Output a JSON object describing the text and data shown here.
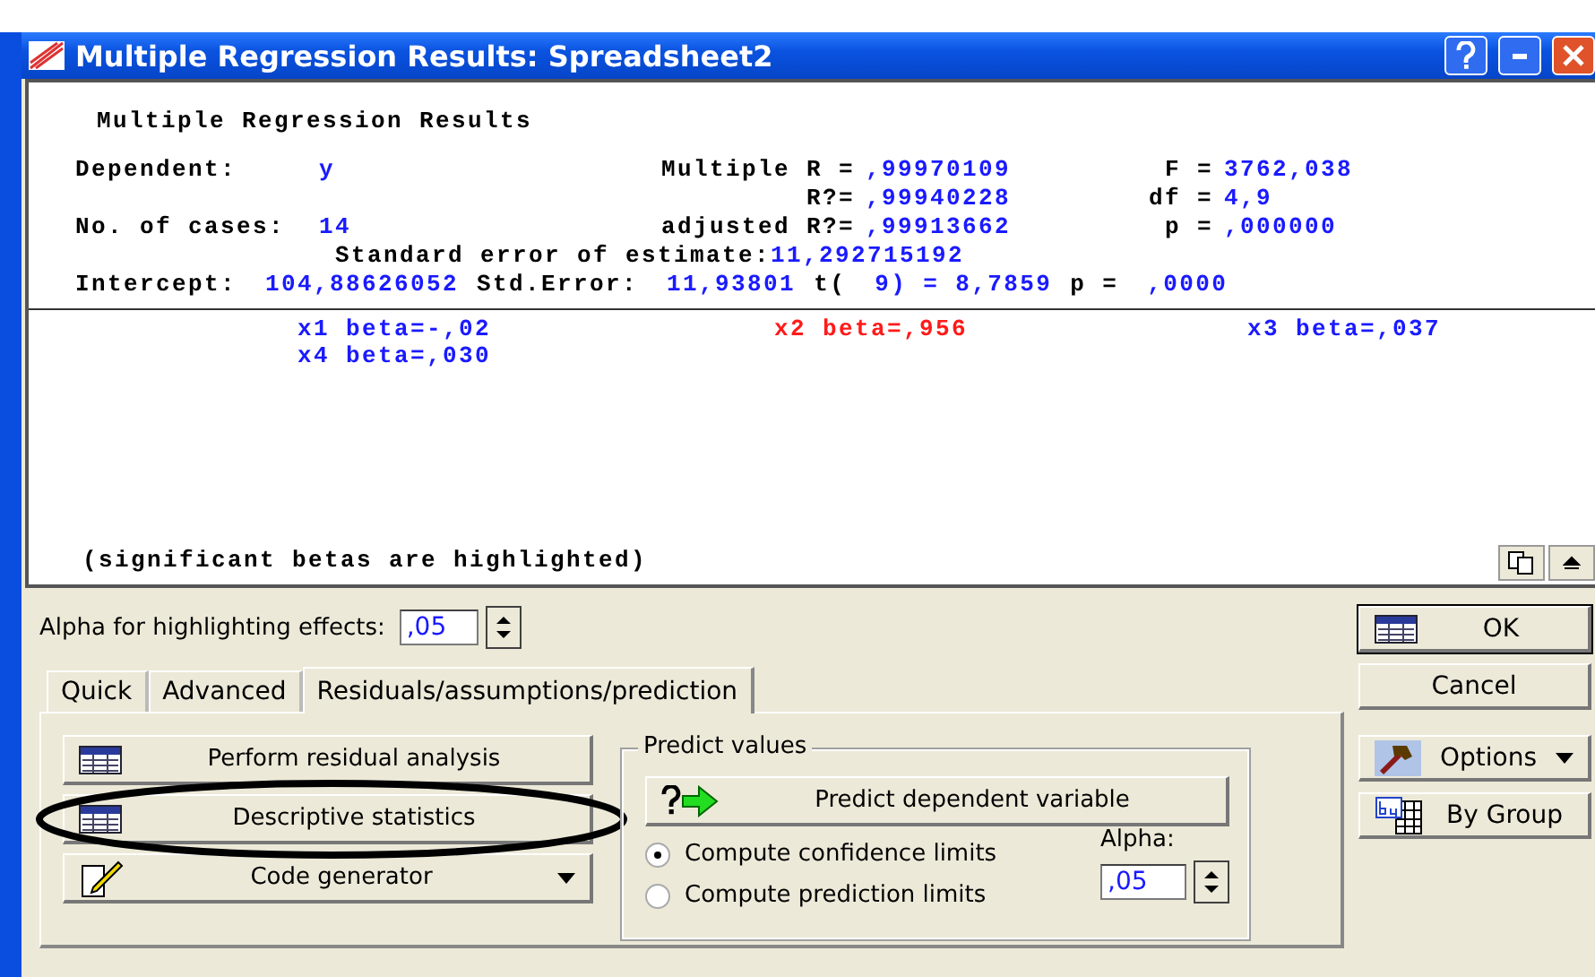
{
  "window": {
    "title": "Multiple Regression Results: Spreadsheet2"
  },
  "report": {
    "heading": "Multiple Regression Results",
    "stats_rows": [
      [
        {
          "label": "Dependent:",
          "value": "y"
        },
        {
          "label": "Multiple R =",
          "value": ",99970109"
        },
        {
          "label": "F =",
          "value": "3762,038"
        }
      ],
      [
        null,
        {
          "label": "R?=",
          "value": ",99940228"
        },
        {
          "label": "df =",
          "value": "4,9"
        }
      ],
      [
        {
          "label": "No. of cases:",
          "value": "14"
        },
        {
          "label": "adjusted R?=",
          "value": ",99913662"
        },
        {
          "label": "p =",
          "value": ",000000"
        }
      ]
    ],
    "std_error": {
      "label": "Standard error of estimate:",
      "value": "11,292715192"
    },
    "intercept_line": [
      {
        "kind": "label",
        "text": "Intercept:"
      },
      {
        "kind": "value",
        "text": "104,88626052"
      },
      {
        "kind": "label",
        "text": "Std.Error:"
      },
      {
        "kind": "value",
        "text": "11,93801"
      },
      {
        "kind": "label",
        "text": "t("
      },
      {
        "kind": "value",
        "text": "9) = 8,7859"
      },
      {
        "kind": "label",
        "text": "p ="
      },
      {
        "kind": "value",
        "text": ",0000"
      }
    ],
    "betas": [
      {
        "text": "x1 beta=-,02",
        "color": "#1a1aff"
      },
      {
        "text": "x2 beta=,956",
        "color": "#ff1a1a"
      },
      {
        "text": "x3 beta=,037",
        "color": "#1a1aff"
      },
      {
        "text": "x4 beta=,030",
        "color": "#1a1aff"
      }
    ],
    "note": "(significant betas are highlighted)"
  },
  "alpha_highlight": {
    "label": "Alpha for highlighting effects:",
    "value": ",05"
  },
  "tabs": [
    {
      "label": "Quick",
      "selected": false
    },
    {
      "label": "Advanced",
      "selected": false
    },
    {
      "label": "Residuals/assumptions/prediction",
      "selected": true
    }
  ],
  "left_buttons": [
    {
      "label": "Perform residual analysis",
      "kind": "table",
      "circled": false
    },
    {
      "label": "Descriptive statistics",
      "kind": "table",
      "circled": true
    },
    {
      "label": "Code generator",
      "kind": "code",
      "circled": false
    }
  ],
  "predict": {
    "title": "Predict values",
    "button": "Predict dependent variable",
    "radios": [
      {
        "label": "Compute confidence limits",
        "selected": true
      },
      {
        "label": "Compute prediction limits",
        "selected": false
      }
    ],
    "alpha_label": "Alpha:",
    "alpha_value": ",05"
  },
  "side_buttons": [
    {
      "label": "OK",
      "kind": "ok"
    },
    {
      "label": "Cancel",
      "kind": "plain"
    },
    {
      "label": "Options",
      "kind": "options"
    },
    {
      "label": "By Group",
      "kind": "bygroup"
    }
  ]
}
